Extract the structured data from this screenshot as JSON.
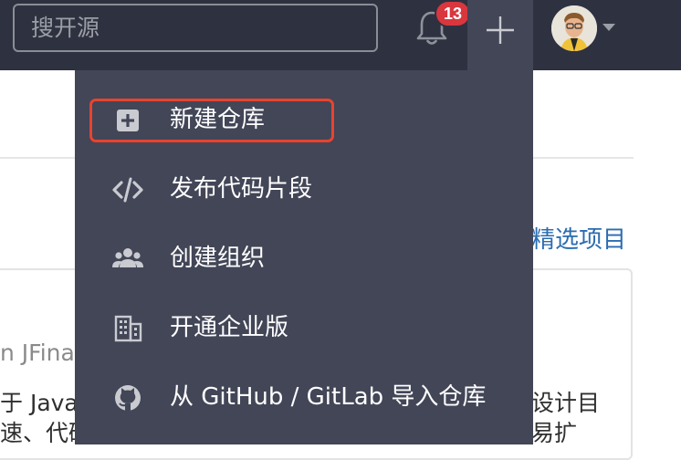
{
  "navbar": {
    "search": {
      "placeholder": "搜开源",
      "value": ""
    },
    "notifications": {
      "count": "13"
    },
    "plus_button": {
      "icon": "plus-icon"
    },
    "avatar": {
      "icon": "user-avatar"
    },
    "colors": {
      "bar_bg": "#2e3140",
      "active_tab_bg": "#424657",
      "badge_bg": "#d9363e"
    }
  },
  "background": {
    "featured_link": "精选项目",
    "card": {
      "title_fragment": "n JFina",
      "line1_left": "于 Java",
      "line2_left": "速、代码",
      "line1_right": "设计目",
      "line2_right": "易扩"
    }
  },
  "dropdown": {
    "items": [
      {
        "label": "新建仓库",
        "icon": "plus-square-icon",
        "highlighted": true
      },
      {
        "label": "发布代码片段",
        "icon": "code-icon"
      },
      {
        "label": "创建组织",
        "icon": "users-icon"
      },
      {
        "label": "开通企业版",
        "icon": "building-icon"
      },
      {
        "label": "从 GitHub / GitLab 导入仓库",
        "icon": "github-icon"
      }
    ],
    "highlight_color": "#e9432f"
  }
}
